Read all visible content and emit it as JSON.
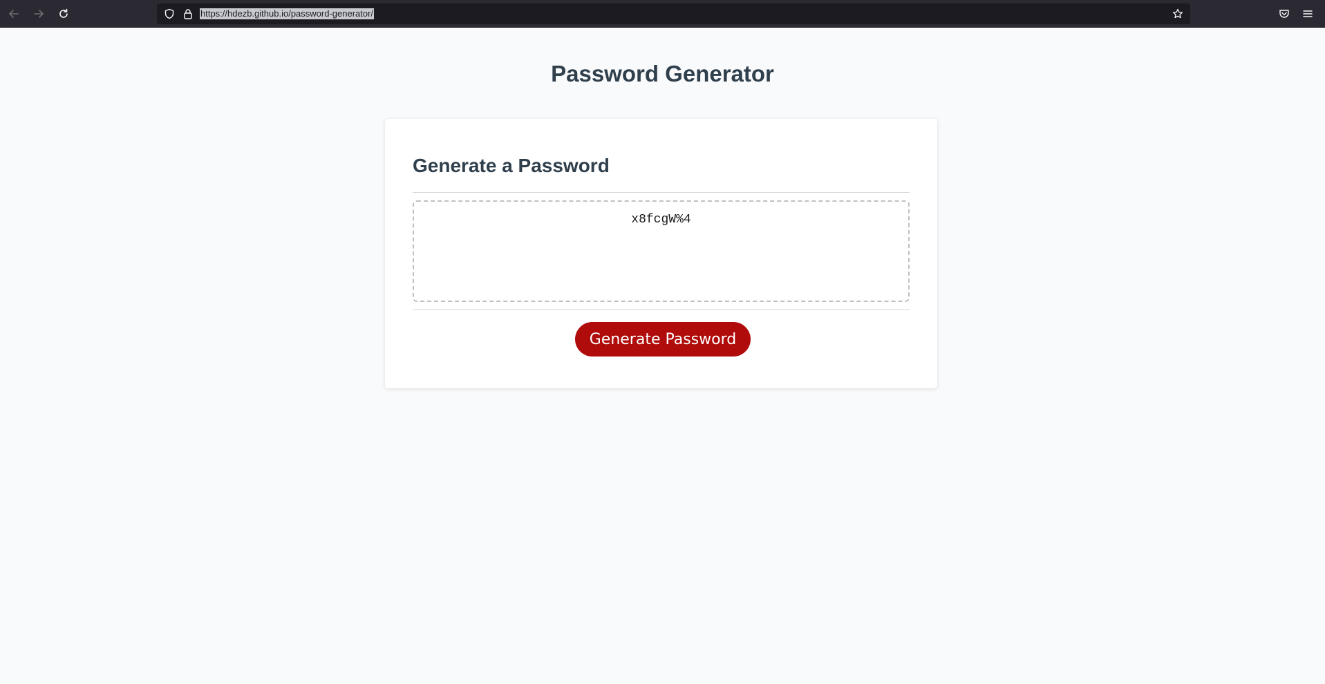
{
  "browser": {
    "url": "https://hdezb.github.io/password-generator/",
    "icons": {
      "back": "arrow-left-icon",
      "forward": "arrow-right-icon",
      "reload": "reload-icon",
      "shield": "shield-icon",
      "lock": "lock-icon",
      "bookmark": "star-icon",
      "pocket": "pocket-icon",
      "menu": "hamburger-menu-icon"
    }
  },
  "page": {
    "title": "Password Generator"
  },
  "card": {
    "title": "Generate a Password",
    "password_value": "x8fcgW%4",
    "button_label": "Generate Password"
  },
  "colors": {
    "heading": "#2f3f4c",
    "button": "#b00c0c",
    "background": "#f9fafb"
  }
}
